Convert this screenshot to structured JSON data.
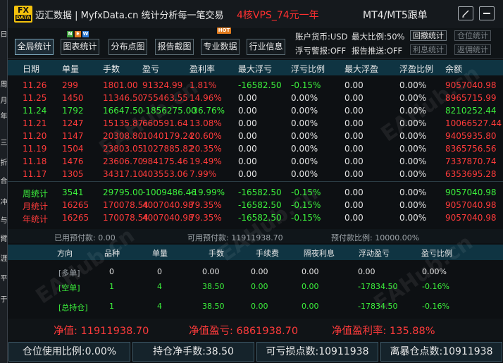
{
  "left_strip": [
    "日",
    "周",
    "月",
    "年",
    "三",
    "折",
    "合",
    "冲",
    "与",
    "臂",
    "涯",
    "平",
    "于"
  ],
  "title_bar": {
    "logo_fx": "FX",
    "logo_data": "DATA",
    "title": "迈汇数据 | MyfxData.cn  统计分析每一笔交易",
    "promo": "4核VPS_74元一年",
    "mt_label": "MT4/MT5跟单",
    "edit_icon": "pencil-icon",
    "menu_icon": "hamburger-icon"
  },
  "toolbar": {
    "buttons": [
      "全局统计",
      "图表统计",
      "分布点图",
      "报告截图",
      "专业数据",
      "行业信息"
    ],
    "badges": {
      "n": "N",
      "e": "E",
      "w": "W",
      "hot": "HOT"
    },
    "account_currency": "账户货币:USD",
    "max_ratio": "最大比例:50%",
    "float_alert": "浮亏警报:OFF",
    "report_push": "报告推送:OFF",
    "right_buttons": [
      "回撤统计",
      "仓位统计",
      "利息统计",
      "返佣统计"
    ]
  },
  "table": {
    "headers": [
      "日期",
      "单量",
      "手数",
      "盈亏",
      "盈利率",
      "最大浮亏",
      "浮亏比例",
      "最大浮盈",
      "浮盈比例",
      "余额"
    ],
    "rows": [
      {
        "date": "11.26",
        "count": "299",
        "lots": "1801.00",
        "pnl": "91324.99",
        "rate": "1.81%",
        "maxloss": "-16582.50",
        "lossratio": "-0.15%",
        "maxgain": "0.00",
        "gainratio": "0.00%",
        "balance": "9057040.98",
        "color": "red"
      },
      {
        "date": "11.25",
        "count": "1450",
        "lots": "11346.50",
        "pnl": "755463.55",
        "rate": "14.96%",
        "maxloss": "0.00",
        "lossratio": "0.00%",
        "maxgain": "0.00",
        "gainratio": "0.00%",
        "balance": "8965715.99",
        "color": "red"
      },
      {
        "date": "11.24",
        "count": "1792",
        "lots": "16647.50",
        "pnl": "-1856275.00",
        "rate": "-36.76%",
        "maxloss": "0.00",
        "lossratio": "0.00%",
        "maxgain": "0.00",
        "gainratio": "0.00%",
        "balance": "8210252.44",
        "color": "grn"
      },
      {
        "date": "11.21",
        "count": "1247",
        "lots": "15135.87",
        "pnl": "660591.64",
        "rate": "13.08%",
        "maxloss": "0.00",
        "lossratio": "0.00%",
        "maxgain": "0.00",
        "gainratio": "0.00%",
        "balance": "10066527.44",
        "color": "red"
      },
      {
        "date": "11.20",
        "count": "1147",
        "lots": "20308.80",
        "pnl": "1040179.24",
        "rate": "20.60%",
        "maxloss": "0.00",
        "lossratio": "0.00%",
        "maxgain": "0.00",
        "gainratio": "0.00%",
        "balance": "9405935.80",
        "color": "red"
      },
      {
        "date": "11.19",
        "count": "1504",
        "lots": "23803.05",
        "pnl": "1027885.82",
        "rate": "20.35%",
        "maxloss": "0.00",
        "lossratio": "0.00%",
        "maxgain": "0.00",
        "gainratio": "0.00%",
        "balance": "8365756.56",
        "color": "red"
      },
      {
        "date": "11.18",
        "count": "1476",
        "lots": "23606.70",
        "pnl": "984175.46",
        "rate": "19.49%",
        "maxloss": "0.00",
        "lossratio": "0.00%",
        "maxgain": "0.00",
        "gainratio": "0.00%",
        "balance": "7337870.74",
        "color": "red"
      },
      {
        "date": "11.17",
        "count": "1305",
        "lots": "34317.10",
        "pnl": "403553.06",
        "rate": "7.99%",
        "maxloss": "0.00",
        "lossratio": "0.00%",
        "maxgain": "0.00",
        "gainratio": "0.00%",
        "balance": "6353695.28",
        "color": "red"
      }
    ],
    "summary": [
      {
        "date": "周统计",
        "count": "3541",
        "lots": "29795.00",
        "pnl": "-1009486.46",
        "rate": "-19.99%",
        "maxloss": "-16582.50",
        "lossratio": "-0.15%",
        "maxgain": "0.00",
        "gainratio": "0.00%",
        "balance": "9057040.98",
        "color": "grn"
      },
      {
        "date": "月统计",
        "count": "16265",
        "lots": "170078.54",
        "pnl": "4007040.98",
        "rate": "79.35%",
        "maxloss": "-16582.50",
        "lossratio": "-0.15%",
        "maxgain": "0.00",
        "gainratio": "0.00%",
        "balance": "9057040.98",
        "color": "red"
      },
      {
        "date": "年统计",
        "count": "16265",
        "lots": "170078.54",
        "pnl": "4007040.98",
        "rate": "79.35%",
        "maxloss": "-16582.50",
        "lossratio": "-0.15%",
        "maxgain": "0.00",
        "gainratio": "0.00%",
        "balance": "9057040.98",
        "color": "red"
      }
    ]
  },
  "funds": {
    "used": "已用预付款: 0.00",
    "available": "可用预付款: 11911938.70",
    "ratio": "预付款比例: 10000.00%"
  },
  "positions": {
    "headers": [
      "方向",
      "品种",
      "单量",
      "手数",
      "手续费",
      "隔夜利息",
      "浮动盈亏",
      "盈亏比例"
    ],
    "rows": [
      {
        "dir": "[多单]",
        "sym": "0",
        "count": "0",
        "lots": "0.00",
        "fee": "0.00",
        "swap": "0.00",
        "pnl": "0.00",
        "ratio": "0.00%"
      },
      {
        "dir": "[空单]",
        "sym": "1",
        "count": "4",
        "lots": "38.50",
        "fee": "0.00",
        "swap": "0.00",
        "pnl": "-17834.50",
        "ratio": "-0.16%"
      },
      {
        "dir": "[总持仓]",
        "sym": "1",
        "count": "4",
        "lots": "38.50",
        "fee": "0.00",
        "swap": "0.00",
        "pnl": "-17834.50",
        "ratio": "-0.16%"
      }
    ]
  },
  "net": {
    "equity": "净值: 11911938.70",
    "equity_pnl": "净值盈亏: 6861938.70",
    "equity_rate": "净值盈利率: 135.88%"
  },
  "bottom": {
    "position_ratio": "仓位使用比例:0.00%",
    "net_lots": "持仓净手数:38.50",
    "loss_points": "可亏损点数:10911938",
    "liq_points": "离暴仓点数:10911938"
  },
  "watermark": "EAHub.cn",
  "colors": {
    "red": "#ff3b3b",
    "green": "#3cf03c",
    "header_bg": "#0f3442",
    "accent_yellow": "#f4c20d"
  }
}
